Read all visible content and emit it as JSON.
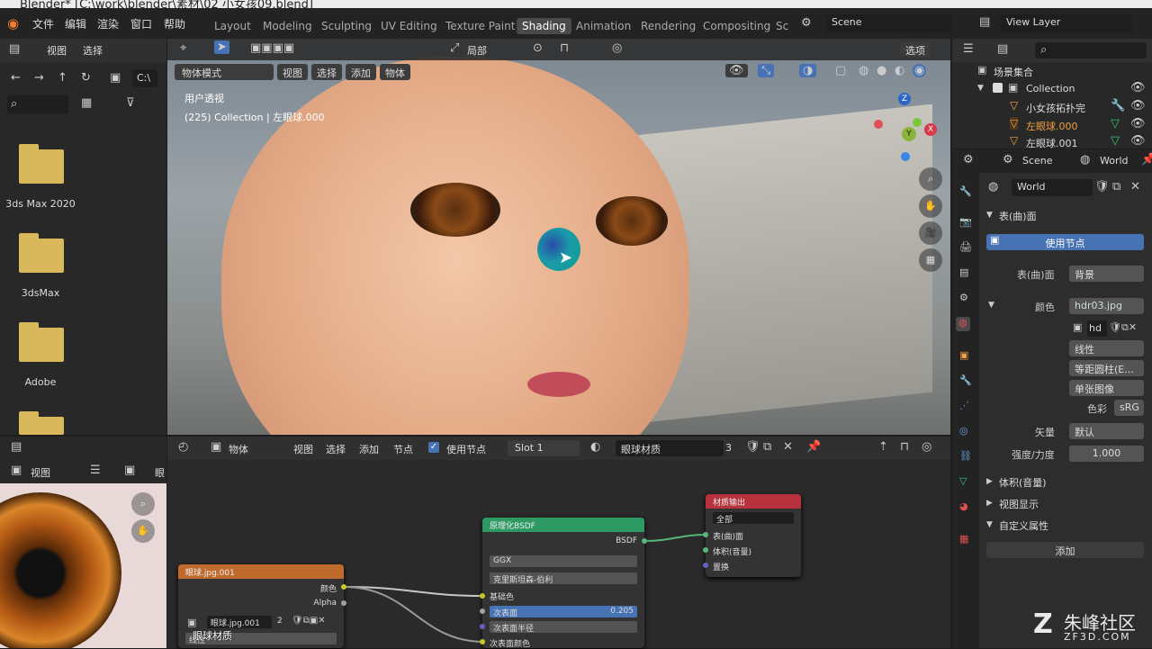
{
  "title": "Blender* [C:\\work\\blender\\素材\\02 小女孩09.blend]",
  "menu": [
    "文件",
    "编辑",
    "渲染",
    "窗口",
    "帮助"
  ],
  "workspaces": [
    "Layout",
    "Modeling",
    "Sculpting",
    "UV Editing",
    "Texture Paint",
    "Shading",
    "Animation",
    "Rendering",
    "Compositing",
    "Sc"
  ],
  "active_workspace": "Shading",
  "scene": "Scene",
  "view_layer": "View Layer",
  "filebrowser": {
    "view": "视图",
    "select": "选择",
    "path": "C:\\",
    "folders": [
      "3ds Max 2020",
      "3dsMax",
      "Adobe"
    ]
  },
  "viewport": {
    "mode": "物体模式",
    "menus": [
      "视图",
      "选择",
      "添加",
      "物体"
    ],
    "transform": "局部",
    "options": "选项",
    "info_line1": "用户透视",
    "info_line2": "(225) Collection | 左眼球.000",
    "gizmo": {
      "z": "Z",
      "y": "Y",
      "x": "X"
    }
  },
  "image_editor": {
    "view": "视图",
    "clipped": "眼"
  },
  "node_editor": {
    "type": "物体",
    "menus": [
      "视图",
      "选择",
      "添加",
      "节点"
    ],
    "use_nodes": "使用节点",
    "slot": "Slot 1",
    "material": "眼球材质",
    "users": "3",
    "overlay": "眼球材质"
  },
  "nodes": {
    "image": {
      "title": "眼球.jpg.001",
      "out_color": "颜色",
      "out_alpha": "Alpha",
      "file": "眼球.jpg.001",
      "users": "2",
      "interp": "线性"
    },
    "bsdf": {
      "title": "原理化BSDF",
      "out": "BSDF",
      "dist": "GGX",
      "sss": "克里斯坦森-伯利",
      "base": "基础色",
      "subsurface": "次表面",
      "subsurface_val": "0.205",
      "radius": "次表面半径",
      "sss_color": "次表面颜色"
    },
    "output": {
      "title": "材质输出",
      "target": "全部",
      "surface": "表(曲)面",
      "volume": "体积(音量)",
      "disp": "置换"
    }
  },
  "outliner": {
    "root": "场景集合",
    "items": [
      "Collection",
      "小女孩拓扑完",
      "左眼球.000",
      "左眼球.001"
    ]
  },
  "properties": {
    "tabs": [
      "Scene",
      "World"
    ],
    "world_name": "World",
    "surface_section": "表(曲)面",
    "use_nodes": "使用节点",
    "surface_label": "表(曲)面",
    "surface_value": "背景",
    "color_label": "颜色",
    "color_value": "hdr03.jpg",
    "image_name": "hd",
    "interp": "线性",
    "projection": "等距圆柱(E...",
    "source": "单张图像",
    "colorspace_label": "色彩",
    "colorspace_value": "sRG",
    "vector_label": "矢量",
    "vector_value": "默认",
    "strength_label": "强度/力度",
    "strength_value": "1.000",
    "sections": [
      "体积(音量)",
      "视图显示",
      "自定义属性"
    ],
    "add": "添加"
  },
  "watermark": {
    "brand": "朱峰社区",
    "url": "ZF3D.COM"
  },
  "colors": {
    "accent": "#4772b3",
    "image_node": "#c06b2e",
    "shader_node": "#2c9a62",
    "output_node": "#b8323e"
  }
}
